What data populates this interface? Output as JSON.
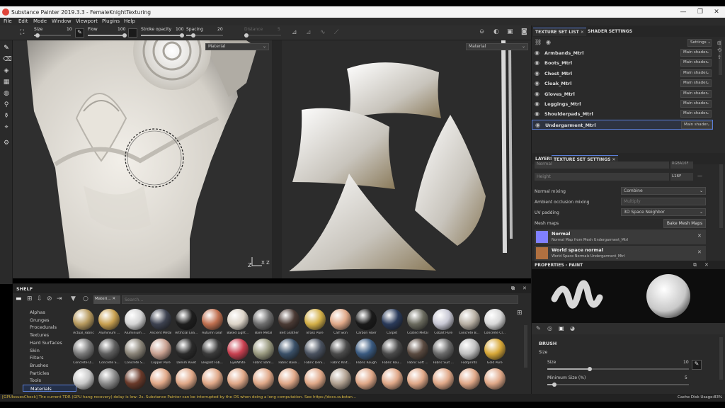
{
  "window": {
    "title": "Substance Painter 2019.3.3 - FemaleKnightTexturing",
    "controls": [
      "—",
      "❐",
      "✕"
    ]
  },
  "menu": [
    "File",
    "Edit",
    "Mode",
    "Window",
    "Viewport",
    "Plugins",
    "Help"
  ],
  "toolbar": {
    "size_label": "Size",
    "size_value": "10",
    "size_fill": 0.1,
    "flow_label": "Flow",
    "flow_value": "100",
    "flow_fill": 1.0,
    "stroke_opacity_label": "Stroke opacity",
    "stroke_opacity_value": "100",
    "stroke_opacity_fill": 1.0,
    "spacing_label": "Spacing",
    "spacing_value": "20",
    "spacing_fill": 0.2,
    "distance_label": "Distance",
    "distance_value": "5",
    "distance_fill": 0.05
  },
  "viewport3d": {
    "mode_label": "Material",
    "axes": "X Z"
  },
  "viewport2d": {
    "mode_label": "Material"
  },
  "texture_set_list": {
    "tab_active": "TEXTURE SET LIST",
    "tab_other": "SHADER SETTINGS",
    "settings_label": "Settings",
    "rows": [
      {
        "name": "Armbands_Mtrl",
        "shader": "Main shader"
      },
      {
        "name": "Boots_Mtrl",
        "shader": "Main shader"
      },
      {
        "name": "Chest_Mtrl",
        "shader": "Main shader"
      },
      {
        "name": "Cloak_Mtrl",
        "shader": "Main shader"
      },
      {
        "name": "Gloves_Mtrl",
        "shader": "Main shader"
      },
      {
        "name": "Leggings_Mtrl",
        "shader": "Main shader"
      },
      {
        "name": "Shoulderpads_Mtrl",
        "shader": "Main shader"
      },
      {
        "name": "Undergarment_Mtrl",
        "shader": "Main shader"
      }
    ],
    "selected_index": 7
  },
  "texture_set_settings": {
    "tab_other": "LAYERS",
    "tab_active": "TEXTURE SET SETTINGS",
    "normal_label": "Normal",
    "normal_format": "RGBA16F",
    "height_label": "Height",
    "height_format": "L16F",
    "normal_mixing_label": "Normal mixing",
    "normal_mixing_value": "Combine",
    "ao_mixing_label": "Ambient occlusion mixing",
    "ao_mixing_value": "Multiply",
    "uv_padding_label": "UV padding",
    "uv_padding_value": "3D Space Neighbor",
    "mesh_maps_label": "Mesh maps",
    "bake_label": "Bake Mesh Maps",
    "maps": [
      {
        "title": "Normal",
        "sub": "Normal Map from Mesh Undergarment_Mtrl",
        "color": "#8080ff"
      },
      {
        "title": "World space normal",
        "sub": "World Space Normals Undergarment_Mtrl",
        "color": "#b07040"
      }
    ]
  },
  "properties": {
    "title": "PROPERTIES - PAINT",
    "brush_header": "BRUSH",
    "size_section": "Size",
    "size_label": "Size",
    "size_value": "10",
    "size_fill": 0.3,
    "min_size_label": "Minimum Size (%)",
    "min_size_value": "5",
    "min_size_fill": 0.05
  },
  "shelf": {
    "title": "SHELF",
    "filter_chip": "Materi...",
    "search_placeholder": "Search...",
    "categories": [
      "Alphas",
      "Grunges",
      "Procedurals",
      "Textures",
      "Hard Surfaces",
      "Skin",
      "Filters",
      "Brushes",
      "Particles",
      "Tools",
      "Materials"
    ],
    "selected_category": "Materials",
    "materials": [
      {
        "name": "Actual_Fabric",
        "color": "#b79a5e"
      },
      {
        "name": "Aluminium ...",
        "color": "#c8a050"
      },
      {
        "name": "Aluminium ...",
        "color": "#d4d4d4"
      },
      {
        "name": "Ancient Metal",
        "color": "#3d4250"
      },
      {
        "name": "Artificial Lea...",
        "color": "#1e1e1e"
      },
      {
        "name": "Autumn Leaf",
        "color": "#c07050"
      },
      {
        "name": "Baked Light...",
        "color": "#dcd4c8"
      },
      {
        "name": "Bare Metal",
        "color": "#6e6e6e"
      },
      {
        "name": "Belt Leather",
        "color": "#4a3a34"
      },
      {
        "name": "Brass Pure",
        "color": "#d4b048"
      },
      {
        "name": "Calf Skin",
        "color": "#e0a888"
      },
      {
        "name": "Carbon Fiber",
        "color": "#1a1a1a"
      },
      {
        "name": "Carpet",
        "color": "#2a3a5a"
      },
      {
        "name": "Coated Metal",
        "color": "#6a6a5e"
      },
      {
        "name": "Cobalt Pure",
        "color": "#c8c8d4"
      },
      {
        "name": "Concrete B...",
        "color": "#b8b0a4"
      },
      {
        "name": "Concrete Cl...",
        "color": "#d8d8d8"
      },
      {
        "name": "Concrete D...",
        "color": "#7a7a7a"
      },
      {
        "name": "Concrete S...",
        "color": "#5e5e5e"
      },
      {
        "name": "Concrete S...",
        "color": "#8a8478"
      },
      {
        "name": "Copper Pure",
        "color": "#c8a090"
      },
      {
        "name": "Denim Rivet",
        "color": "#2a2a2a"
      },
      {
        "name": "Elegant Fab...",
        "color": "#3a3a3a"
      },
      {
        "name": "EyeWhite",
        "color": "#c84050"
      },
      {
        "name": "Fabric Bam...",
        "color": "#9a9a80"
      },
      {
        "name": "Fabric Base...",
        "color": "#3a5068"
      },
      {
        "name": "Fabric Deni...",
        "color": "#4a5260"
      },
      {
        "name": "Fabric Knit...",
        "color": "#4a4a4a"
      },
      {
        "name": "Fabric Rough",
        "color": "#3a5a80"
      },
      {
        "name": "Fabric Rou...",
        "color": "#4a4a4a"
      },
      {
        "name": "Fabric Soft ...",
        "color": "#5a4a40"
      },
      {
        "name": "Fabric Suit ...",
        "color": "#6a6a6a"
      },
      {
        "name": "Footprints",
        "color": "#c0c0c0"
      },
      {
        "name": "Gold Pure",
        "color": "#d8a838"
      },
      {
        "name": "Marble",
        "color": "#c8c8c8"
      },
      {
        "name": "Metal Rough",
        "color": "#8a8a8a"
      },
      {
        "name": "Old Wood",
        "color": "#6a3a2a"
      },
      {
        "name": "Skin",
        "color": "#e0a888"
      },
      {
        "name": "Skin",
        "color": "#e0a888"
      },
      {
        "name": "Skin",
        "color": "#e0a888"
      },
      {
        "name": "Skin",
        "color": "#e0a888"
      },
      {
        "name": "Skin",
        "color": "#e0a888"
      },
      {
        "name": "Skin",
        "color": "#e0a888"
      },
      {
        "name": "Skin",
        "color": "#e0a888"
      },
      {
        "name": "Patterned",
        "color": "#b0a090"
      },
      {
        "name": "Skin",
        "color": "#e0a888"
      },
      {
        "name": "Skin",
        "color": "#e0a888"
      },
      {
        "name": "Skin",
        "color": "#e0a888"
      },
      {
        "name": "Skin",
        "color": "#e0a888"
      },
      {
        "name": "Skin",
        "color": "#e0a888"
      },
      {
        "name": "Skin",
        "color": "#e0a888"
      }
    ]
  },
  "status": {
    "message": "[GPUIssuesCheck] The current TDR (GPU hang recovery) delay is low: 2s. Substance Painter can be interrupted by the OS when doing a long computation. See https://docs.substan...",
    "disk_label": "Cache Disk Usage:",
    "disk_value": "83%"
  }
}
